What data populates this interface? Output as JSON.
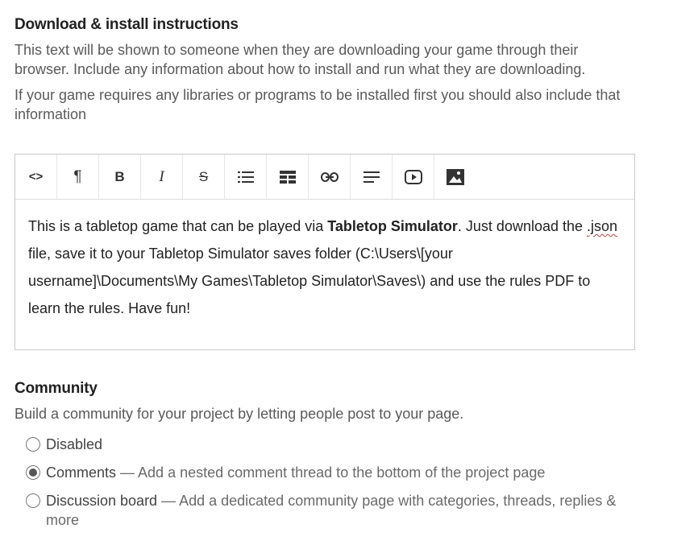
{
  "download": {
    "title": "Download & install instructions",
    "desc1": "This text will be shown to someone when they are downloading your game through their browser. Include any information about how to install and run what they are downloading.",
    "desc2": "If your game requires any libraries or programs to be installed first you should also include that information"
  },
  "editor": {
    "toolbar": {
      "code": "<>",
      "paragraph": "¶",
      "bold": "B",
      "italic": "I",
      "strike": "S"
    },
    "content": {
      "part1": "This is a tabletop game that can be played via ",
      "bold": "Tabletop Simulator",
      "part2": ". Just download the ",
      "misspelled": ".json",
      "part3": " file, save it to your Tabletop Simulator saves folder (C:\\Users\\[your username]\\Documents\\My Games\\Tabletop Simulator\\Saves\\) and use the rules PDF to learn the rules. Have fun!"
    }
  },
  "community": {
    "title": "Community",
    "desc": "Build a community for your project by letting people post to your page.",
    "options": [
      {
        "label": "Disabled",
        "desc": "",
        "checked": false
      },
      {
        "label": "Comments",
        "desc": " — Add a nested comment thread to the bottom of the project page",
        "checked": true
      },
      {
        "label": "Discussion board",
        "desc": " — Add a dedicated community page with categories, threads, replies & more",
        "checked": false
      }
    ]
  }
}
